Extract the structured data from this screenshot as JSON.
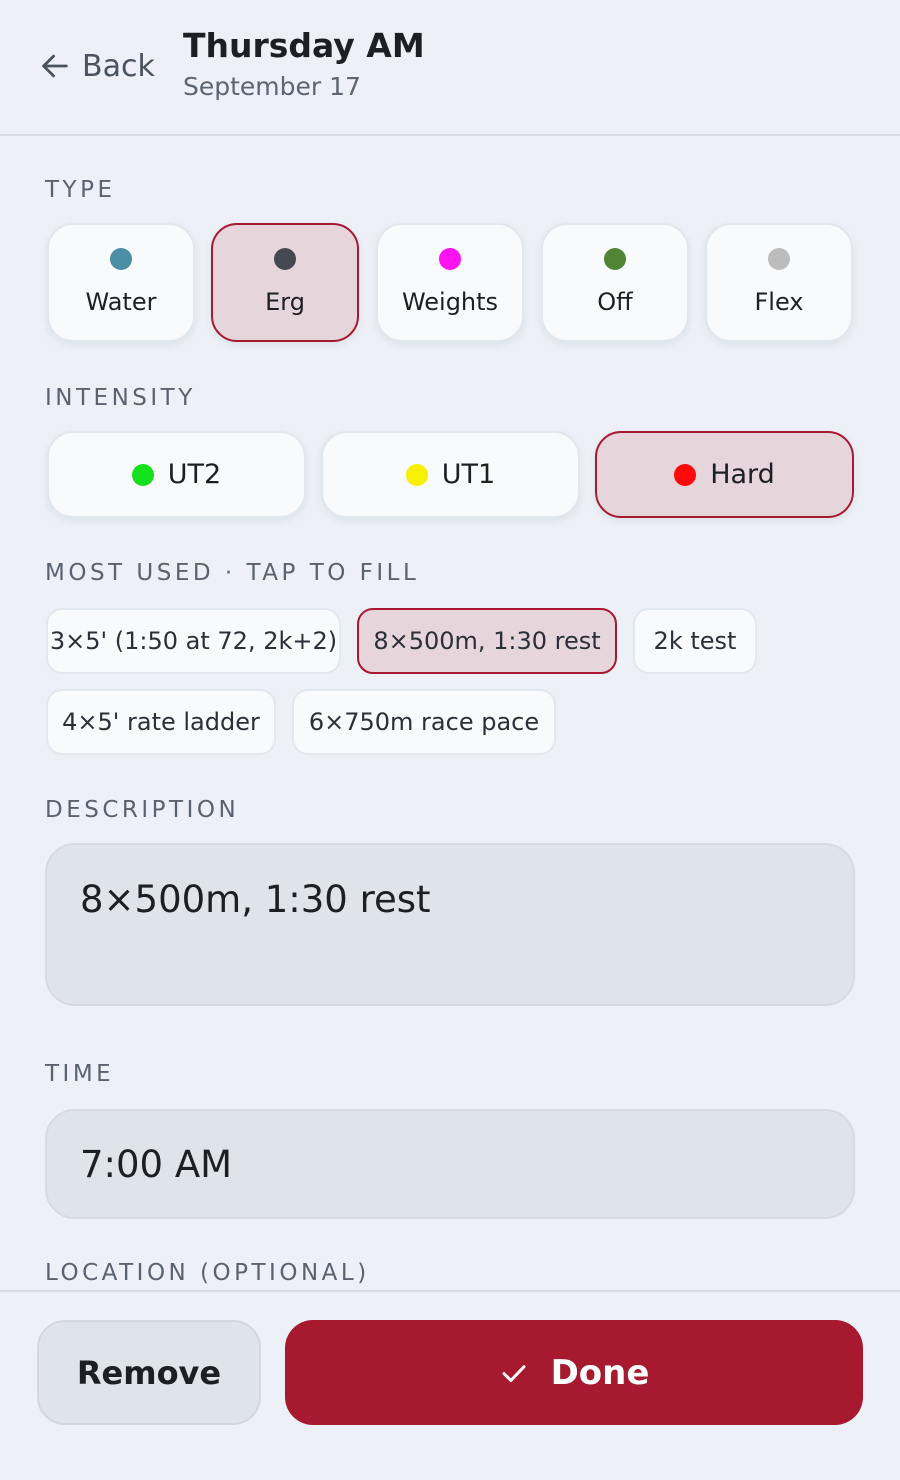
{
  "header": {
    "back_label": "Back",
    "title": "Thursday AM",
    "subtitle": "September 17"
  },
  "type_section": {
    "label": "TYPE",
    "selected": "Erg",
    "options": [
      {
        "label": "Water",
        "color": "#4a8fa3"
      },
      {
        "label": "Erg",
        "color": "#454a52"
      },
      {
        "label": "Weights",
        "color": "#ff12f0"
      },
      {
        "label": "Off",
        "color": "#4f8534"
      },
      {
        "label": "Flex",
        "color": "#bcbcbc"
      }
    ]
  },
  "intensity_section": {
    "label": "INTENSITY",
    "selected": "Hard",
    "options": [
      {
        "label": "UT2",
        "color": "#14e01c"
      },
      {
        "label": "UT1",
        "color": "#f7f000"
      },
      {
        "label": "Hard",
        "color": "#ff0a0a"
      }
    ]
  },
  "most_used": {
    "label": "MOST USED · TAP TO FILL",
    "selected": "8×500m, 1:30 rest",
    "items": [
      "3×5' (1:50 at 72, 2k+2)",
      "8×500m, 1:30 rest",
      "2k test",
      "4×5' rate ladder",
      "6×750m race pace"
    ]
  },
  "description": {
    "label": "DESCRIPTION",
    "value": "8×500m, 1:30 rest"
  },
  "time": {
    "label": "TIME",
    "value": "7:00 AM"
  },
  "location": {
    "label": "LOCATION (OPTIONAL)"
  },
  "footer": {
    "remove_label": "Remove",
    "done_label": "Done"
  },
  "colors": {
    "accent": "#a6192e",
    "selected_bg": "#e6d6dc",
    "background": "#edf1f7"
  }
}
